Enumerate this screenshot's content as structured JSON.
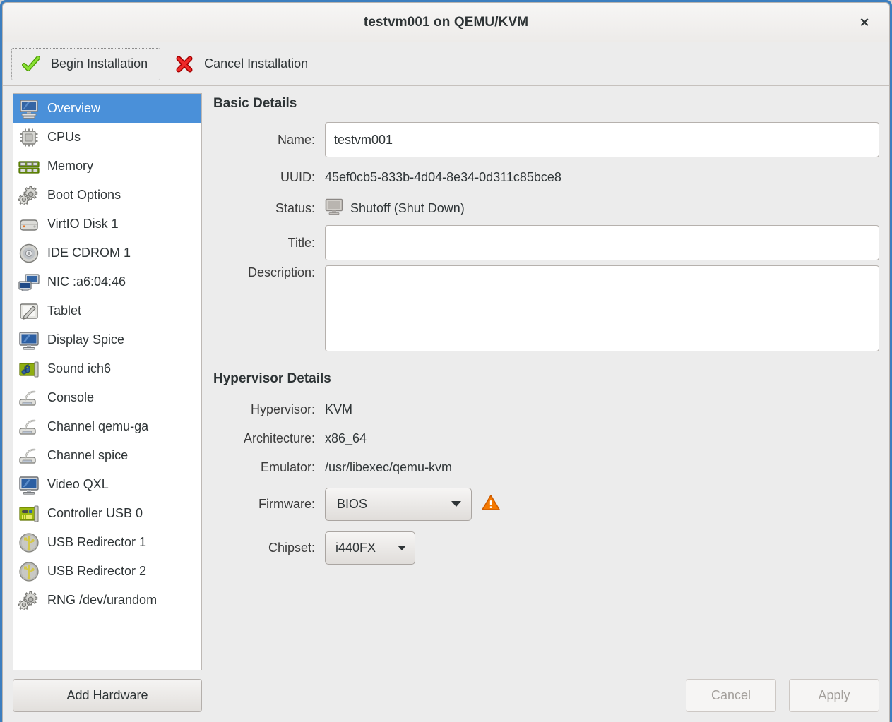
{
  "window": {
    "title": "testvm001 on QEMU/KVM",
    "close_label": "×",
    "accent_color": "#3c7ebf",
    "selection_color": "#4a90d9"
  },
  "toolbar": {
    "begin_installation": "Begin Installation",
    "cancel_installation": "Cancel Installation",
    "begin_icon": "green-check-icon",
    "cancel_icon": "red-x-icon"
  },
  "sidebar": {
    "items": [
      {
        "label": "Overview",
        "icon": "computer-monitor-icon",
        "selected": true
      },
      {
        "label": "CPUs",
        "icon": "cpu-chip-icon",
        "selected": false
      },
      {
        "label": "Memory",
        "icon": "memory-ram-icon",
        "selected": false
      },
      {
        "label": "Boot Options",
        "icon": "gears-icon",
        "selected": false
      },
      {
        "label": "VirtIO Disk 1",
        "icon": "harddisk-icon",
        "selected": false
      },
      {
        "label": "IDE CDROM 1",
        "icon": "optical-disc-icon",
        "selected": false
      },
      {
        "label": "NIC :a6:04:46",
        "icon": "network-card-icon",
        "selected": false
      },
      {
        "label": "Tablet",
        "icon": "tablet-pen-icon",
        "selected": false
      },
      {
        "label": "Display Spice",
        "icon": "display-icon",
        "selected": false
      },
      {
        "label": "Sound ich6",
        "icon": "sound-card-icon",
        "selected": false
      },
      {
        "label": "Console",
        "icon": "serial-console-icon",
        "selected": false
      },
      {
        "label": "Channel qemu-ga",
        "icon": "serial-console-icon",
        "selected": false
      },
      {
        "label": "Channel spice",
        "icon": "serial-console-icon",
        "selected": false
      },
      {
        "label": "Video QXL",
        "icon": "display-icon",
        "selected": false
      },
      {
        "label": "Controller USB 0",
        "icon": "controller-card-icon",
        "selected": false
      },
      {
        "label": "USB Redirector 1",
        "icon": "usb-icon",
        "selected": false
      },
      {
        "label": "USB Redirector 2",
        "icon": "usb-icon",
        "selected": false
      },
      {
        "label": "RNG /dev/urandom",
        "icon": "gears-icon",
        "selected": false
      }
    ],
    "add_hardware": "Add Hardware"
  },
  "basic_details": {
    "heading": "Basic Details",
    "name_label": "Name:",
    "name_value": "testvm001",
    "uuid_label": "UUID:",
    "uuid_value": "45ef0cb5-833b-4d04-8e34-0d311c85bce8",
    "status_label": "Status:",
    "status_value": "Shutoff (Shut Down)",
    "status_icon": "shutoff-monitor-icon",
    "title_label": "Title:",
    "title_value": "",
    "description_label": "Description:",
    "description_value": ""
  },
  "hypervisor_details": {
    "heading": "Hypervisor Details",
    "hypervisor_label": "Hypervisor:",
    "hypervisor_value": "KVM",
    "architecture_label": "Architecture:",
    "architecture_value": "x86_64",
    "emulator_label": "Emulator:",
    "emulator_value": "/usr/libexec/qemu-kvm",
    "firmware_label": "Firmware:",
    "firmware_value": "BIOS",
    "firmware_warning_icon": "warning-triangle-icon",
    "chipset_label": "Chipset:",
    "chipset_value": "i440FX"
  },
  "footer": {
    "cancel": "Cancel",
    "apply": "Apply"
  }
}
